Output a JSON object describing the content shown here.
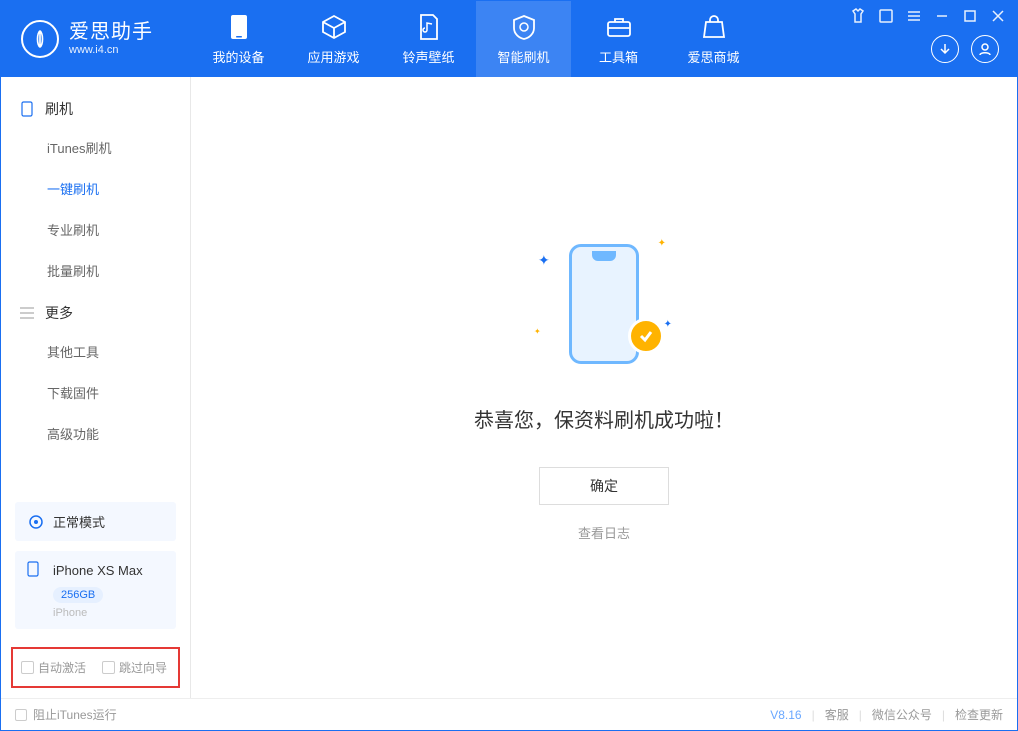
{
  "app": {
    "title": "爱思助手",
    "subtitle": "www.i4.cn"
  },
  "nav": {
    "tabs": [
      {
        "label": "我的设备"
      },
      {
        "label": "应用游戏"
      },
      {
        "label": "铃声壁纸"
      },
      {
        "label": "智能刷机"
      },
      {
        "label": "工具箱"
      },
      {
        "label": "爱思商城"
      }
    ]
  },
  "sidebar": {
    "sec1_title": "刷机",
    "sec1_items": [
      {
        "label": "iTunes刷机"
      },
      {
        "label": "一键刷机"
      },
      {
        "label": "专业刷机"
      },
      {
        "label": "批量刷机"
      }
    ],
    "sec2_title": "更多",
    "sec2_items": [
      {
        "label": "其他工具"
      },
      {
        "label": "下载固件"
      },
      {
        "label": "高级功能"
      }
    ]
  },
  "device": {
    "mode": "正常模式",
    "name": "iPhone XS Max",
    "storage": "256GB",
    "type": "iPhone"
  },
  "options": {
    "auto_activate": "自动激活",
    "skip_guide": "跳过向导"
  },
  "main": {
    "message": "恭喜您，保资料刷机成功啦！",
    "ok": "确定",
    "view_log": "查看日志"
  },
  "footer": {
    "block_itunes": "阻止iTunes运行",
    "version": "V8.16",
    "support": "客服",
    "wechat": "微信公众号",
    "update": "检查更新"
  }
}
